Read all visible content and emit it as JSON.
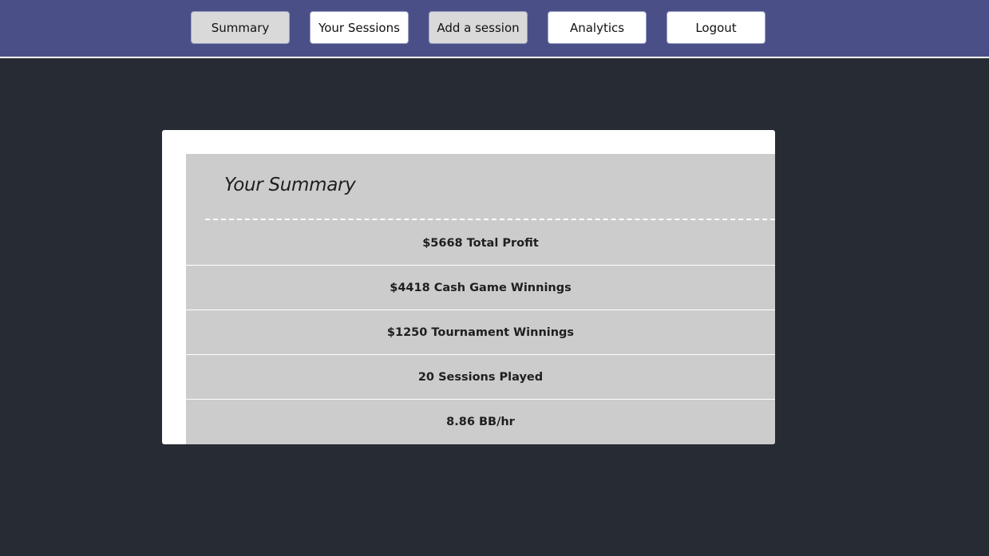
{
  "nav": {
    "summary_label": "Summary",
    "sessions_label": "Your Sessions",
    "add_session_label": "Add a session",
    "analytics_label": "Analytics",
    "logout_label": "Logout"
  },
  "summary": {
    "title": "Your Summary",
    "stats": [
      "$5668 Total Profit",
      "$4418 Cash Game Winnings",
      "$1250 Tournament Winnings",
      "20 Sessions Played",
      "8.86 BB/hr"
    ]
  },
  "colors": {
    "navbar": "#4a5087",
    "background": "#272b33",
    "card": "#ffffff",
    "summary_box": "#cccccc",
    "active_button": "#d9d9d9"
  }
}
